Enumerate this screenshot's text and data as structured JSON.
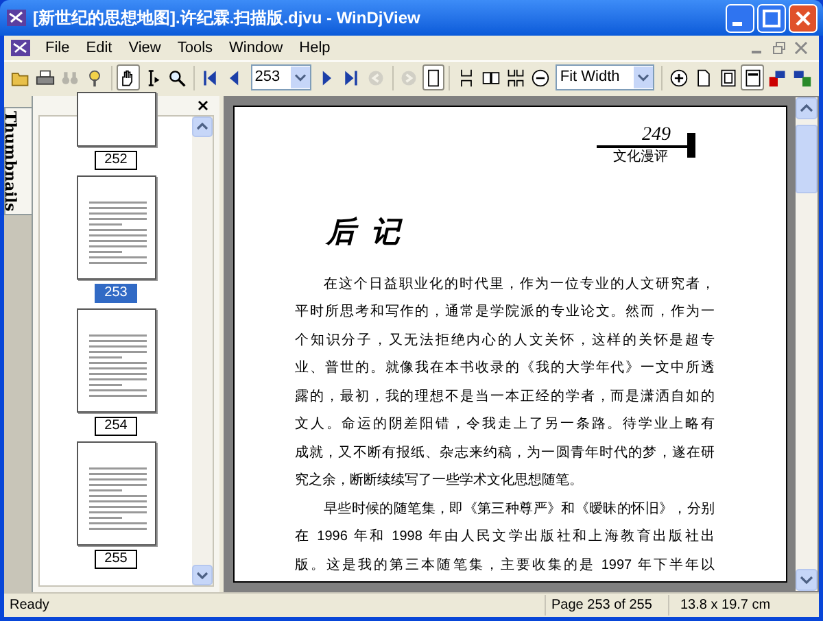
{
  "window": {
    "title": "[新世纪的思想地图].许纪霖.扫描版.djvu - WinDjView"
  },
  "menu": [
    "File",
    "Edit",
    "View",
    "Tools",
    "Window",
    "Help"
  ],
  "toolbar": {
    "buttons": [
      {
        "pressed": false,
        "disabled": false
      },
      {
        "pressed": false,
        "disabled": false
      },
      {
        "pressed": false,
        "disabled": true
      },
      {
        "pressed": false,
        "disabled": false
      },
      {
        "pressed": true,
        "disabled": false
      },
      {
        "pressed": false,
        "disabled": false
      },
      {
        "pressed": false,
        "disabled": false
      },
      {
        "pressed": false,
        "disabled": false
      },
      {
        "pressed": false,
        "disabled": false
      },
      {
        "pressed": false,
        "disabled": false
      },
      {
        "pressed": false,
        "disabled": false
      },
      {
        "pressed": false,
        "disabled": true
      },
      {
        "pressed": false,
        "disabled": true
      },
      {
        "pressed": true,
        "disabled": false
      },
      {
        "pressed": false,
        "disabled": false
      },
      {
        "pressed": false,
        "disabled": false
      },
      {
        "pressed": false,
        "disabled": false
      },
      {
        "pressed": false,
        "disabled": false
      },
      {
        "pressed": false,
        "disabled": false
      },
      {
        "pressed": false,
        "disabled": false
      },
      {
        "pressed": false,
        "disabled": false
      },
      {
        "pressed": true,
        "disabled": false
      },
      {
        "pressed": false,
        "disabled": false
      },
      {
        "pressed": false,
        "disabled": false
      }
    ],
    "page_combo": {
      "value": "253"
    },
    "zoom_combo": {
      "value": "Fit Width"
    }
  },
  "sidebar": {
    "tab": "Thumbnails",
    "thumbnails": [
      {
        "label": "252",
        "selected": false
      },
      {
        "label": "253",
        "selected": true
      },
      {
        "label": "254",
        "selected": false
      },
      {
        "label": "255",
        "selected": false
      }
    ]
  },
  "page": {
    "number": "249",
    "section": "文化漫评",
    "title": "后  记",
    "lines": [
      {
        "text": "在这个日益职业化的时代里，作为一位专业的人文研究者，",
        "indent": true,
        "full": true
      },
      {
        "text": "平时所思考和写作的，通常是学院派的专业论文。然而，作为一",
        "indent": false,
        "full": true
      },
      {
        "text": "个知识分子，又无法拒绝内心的人文关怀，这样的关怀是超专",
        "indent": false,
        "full": true
      },
      {
        "text": "业、普世的。就像我在本书收录的《我的大学年代》一文中所透",
        "indent": false,
        "full": true
      },
      {
        "text": "露的，最初，我的理想不是当一本正经的学者，而是潇洒自如的",
        "indent": false,
        "full": true
      },
      {
        "text": "文人。命运的阴差阳错，令我走上了另一条路。待学业上略有",
        "indent": false,
        "full": true
      },
      {
        "text": "成就，又不断有报纸、杂志来约稿，为一圆青年时代的梦，遂在研",
        "indent": false,
        "full": true
      },
      {
        "text": "究之余，断断续续写了一些学术文化思想随笔。",
        "indent": false,
        "full": false
      },
      {
        "text": "早些时候的随笔集，即《第三种尊严》和《暧昧的怀旧》，分别",
        "indent": true,
        "full": true
      },
      {
        "text": "在 1996 年和 1998 年由人民文学出版社和上海教育出版社出",
        "indent": false,
        "full": true
      },
      {
        "text": "版。这是我的第三本随笔集，主要收集的是 1997 年下半年以",
        "indent": false,
        "full": true
      }
    ]
  },
  "status_bar": {
    "message": "Ready",
    "page": "Page 253 of 255",
    "size": "13.8 x 19.7 cm"
  }
}
